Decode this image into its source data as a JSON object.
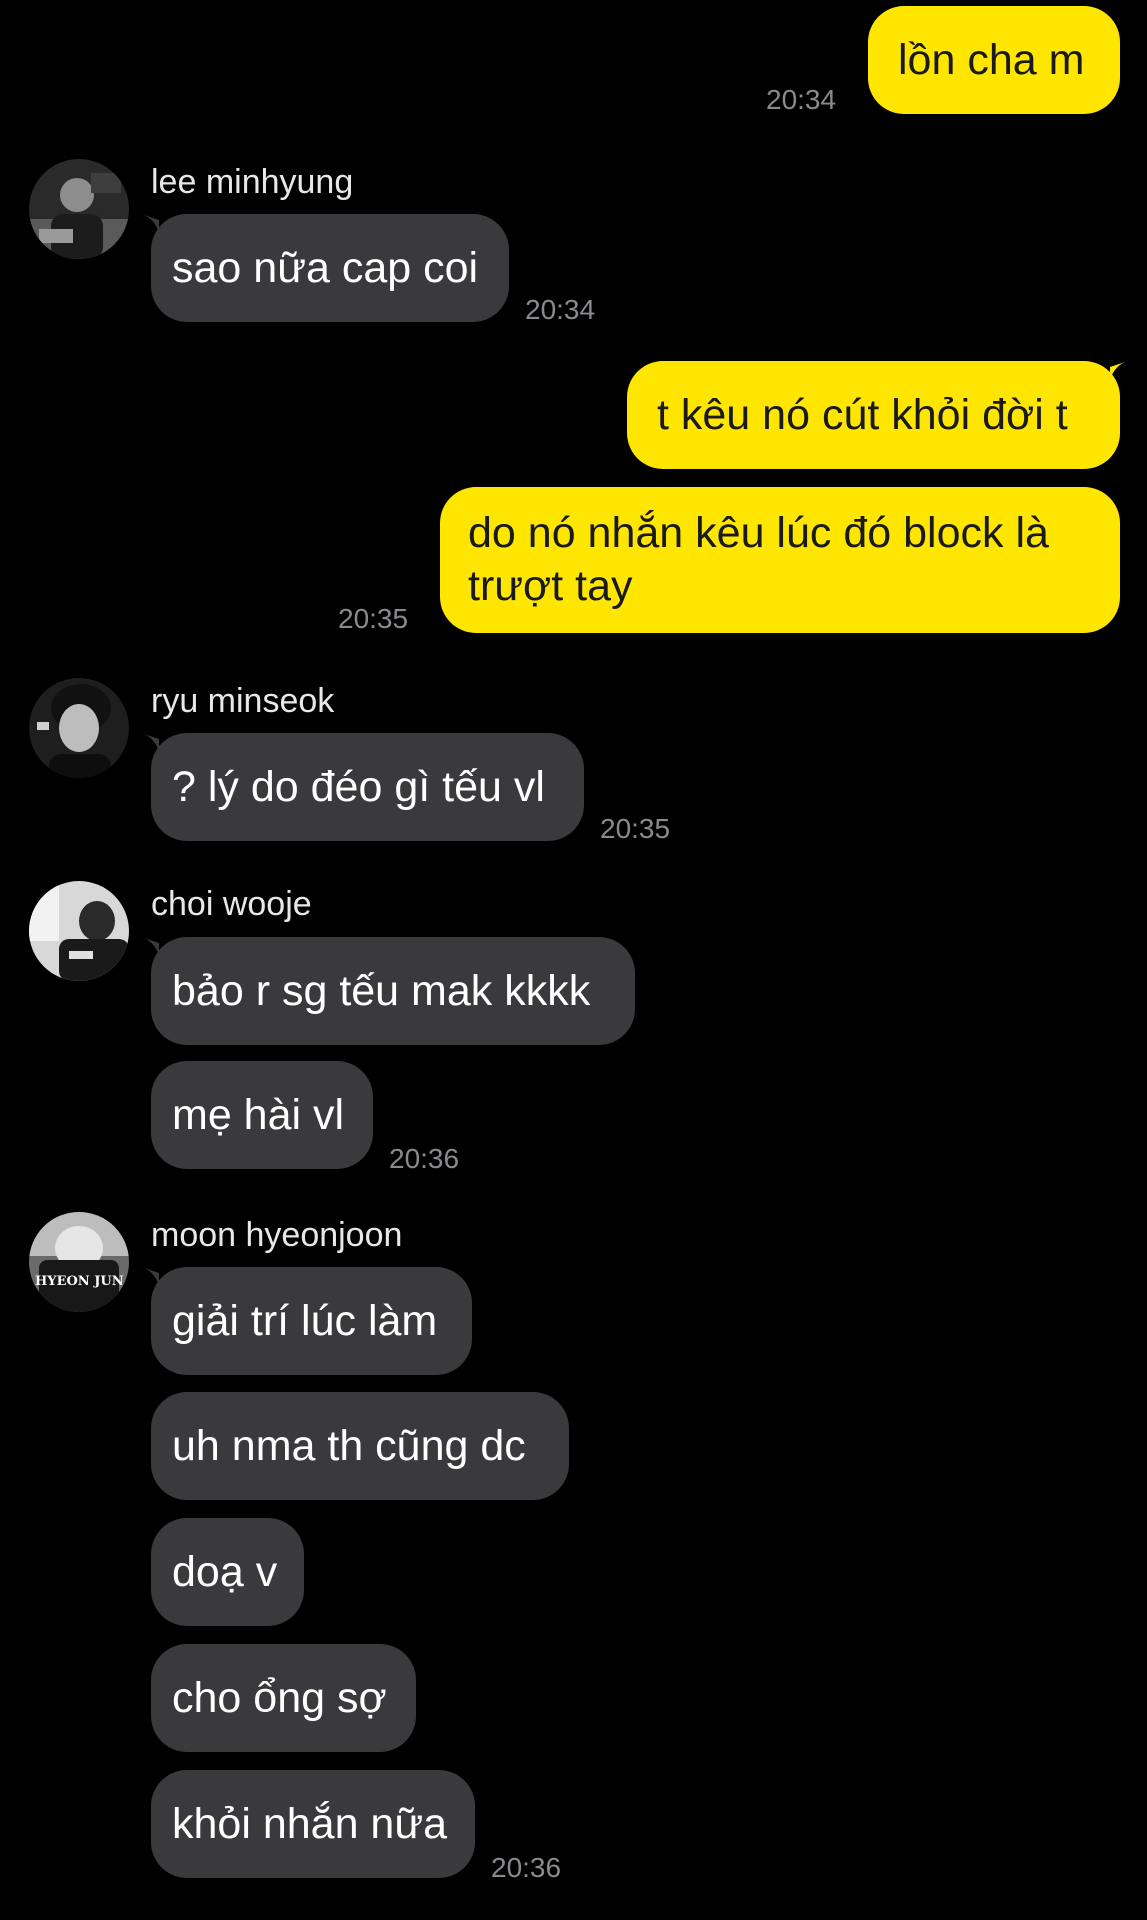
{
  "colors": {
    "background": "#000000",
    "outgoing_bubble": "#ffe600",
    "incoming_bubble": "#3a3a3c",
    "timestamp": "#8a8a8e"
  },
  "chat": {
    "msg1": {
      "text": "lồn cha m",
      "time": "20:34"
    },
    "group1": {
      "sender": "lee minhyung",
      "messages": [
        {
          "text": "sao nữa cap coi"
        }
      ],
      "time": "20:34"
    },
    "msg2": {
      "text": "t kêu nó cút khỏi đời t"
    },
    "msg3": {
      "text": "do nó nhắn kêu lúc đó block là trượt tay",
      "time": "20:35"
    },
    "group2": {
      "sender": "ryu minseok",
      "messages": [
        {
          "text": "? lý do đéo gì tếu vl"
        }
      ],
      "time": "20:35"
    },
    "group3": {
      "sender": "choi wooje",
      "messages": [
        {
          "text": "bảo r sg tếu mak kkkk"
        },
        {
          "text": "mẹ hài vl"
        }
      ],
      "time": "20:36"
    },
    "group4": {
      "sender": "moon hyeonjoon",
      "avatar_text": "HYEON JUN",
      "messages": [
        {
          "text": "giải trí lúc làm"
        },
        {
          "text": "uh nma th cũng dc"
        },
        {
          "text": "doạ v"
        },
        {
          "text": "cho ổng sợ"
        },
        {
          "text": "khỏi nhắn nữa"
        }
      ],
      "time": "20:36"
    }
  }
}
